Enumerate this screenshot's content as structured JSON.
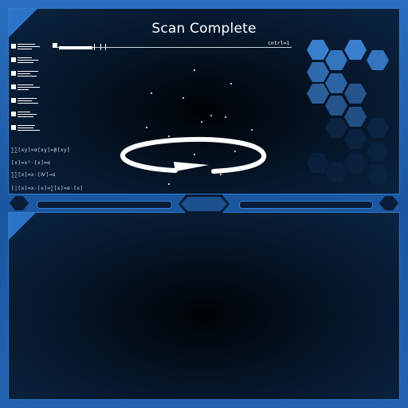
{
  "screen": {
    "title": "Scan Complete",
    "slider_label": "cntrl=1",
    "formulas": [
      "∑∑[xy]=α[xy]=β[xy]",
      "[x]=x²·[x]=α",
      "∑∑[x]=x·[Ⅳ]→α",
      "[|[x]=x·[x]=∑[x]=α·[x]"
    ],
    "scan_progress": 1.0
  },
  "colors": {
    "frame": "#1d5aa3",
    "accent": "#2d74c6",
    "panel_dark": "#06172b",
    "hex_bright": "#3a7fcd",
    "hex_dim": "#12355f",
    "text": "#ffffff"
  },
  "icons": {
    "spinner": "circular-arrow-icon",
    "corner": "triangle-corner-icon"
  }
}
